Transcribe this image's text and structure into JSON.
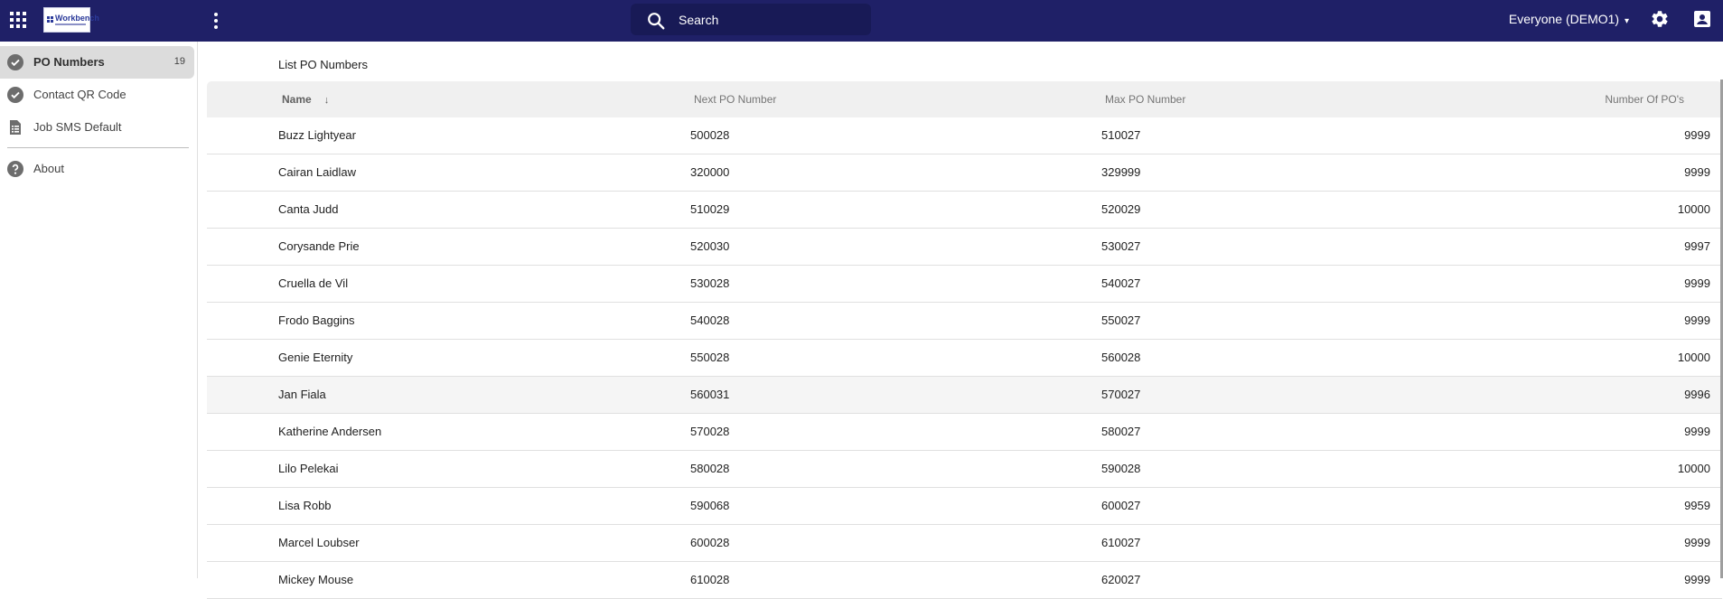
{
  "topbar": {
    "logo_text": "Workbench",
    "search_placeholder": "Search",
    "workspace_label": "Everyone (DEMO1)",
    "workspace_caret": "▾"
  },
  "sidebar": {
    "items": [
      {
        "label": "PO Numbers",
        "count": "19",
        "icon": "check-circle-icon",
        "active": true
      },
      {
        "label": "Contact QR Code",
        "icon": "check-circle-icon"
      },
      {
        "label": "Job SMS Default",
        "icon": "document-list-icon"
      },
      {
        "label": "About",
        "icon": "help-circle-icon"
      }
    ]
  },
  "main": {
    "title": "List PO Numbers",
    "columns": {
      "name": "Name",
      "sort_indicator": "↓",
      "next": "Next PO Number",
      "max": "Max PO Number",
      "count": "Number Of PO's"
    },
    "rows": [
      {
        "name": "Buzz Lightyear",
        "next": "500028",
        "max": "510027",
        "count": "9999"
      },
      {
        "name": "Cairan Laidlaw",
        "next": "320000",
        "max": "329999",
        "count": "9999"
      },
      {
        "name": "Canta Judd",
        "next": "510029",
        "max": "520029",
        "count": "10000"
      },
      {
        "name": "Corysande Prie",
        "next": "520030",
        "max": "530027",
        "count": "9997"
      },
      {
        "name": "Cruella de Vil",
        "next": "530028",
        "max": "540027",
        "count": "9999"
      },
      {
        "name": "Frodo Baggins",
        "next": "540028",
        "max": "550027",
        "count": "9999"
      },
      {
        "name": "Genie Eternity",
        "next": "550028",
        "max": "560028",
        "count": "10000"
      },
      {
        "name": "Jan Fiala",
        "next": "560031",
        "max": "570027",
        "count": "9996"
      },
      {
        "name": "Katherine Andersen",
        "next": "570028",
        "max": "580027",
        "count": "9999"
      },
      {
        "name": "Lilo Pelekai",
        "next": "580028",
        "max": "590028",
        "count": "10000"
      },
      {
        "name": "Lisa Robb",
        "next": "590068",
        "max": "600027",
        "count": "9959"
      },
      {
        "name": "Marcel Loubser",
        "next": "600028",
        "max": "610027",
        "count": "9999"
      },
      {
        "name": "Mickey Mouse",
        "next": "610028",
        "max": "620027",
        "count": "9999"
      }
    ]
  },
  "colors": {
    "topbar": "#1f2067",
    "search_bg": "#181a56",
    "active_nav": "#dcdcdc",
    "header_bg": "#f0f0f0"
  }
}
